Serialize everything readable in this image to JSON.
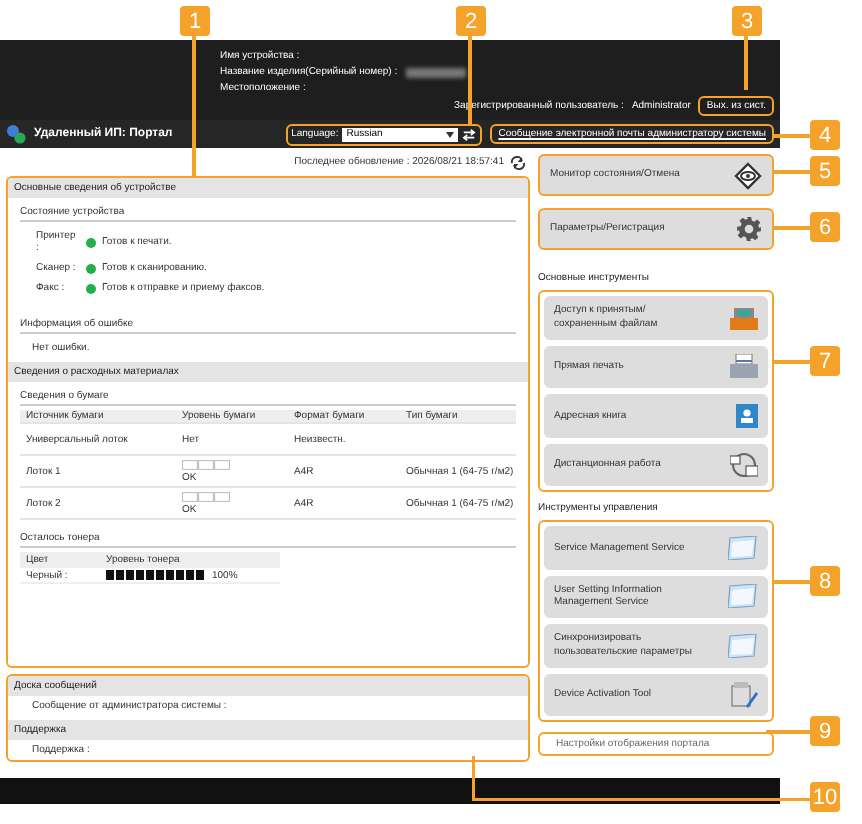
{
  "header": {
    "device_name_label": "Имя устройства :",
    "product_label": "Название изделия(Серийный номер) :",
    "location_label": "Местоположение :",
    "user_label": "Зарегистрированный пользователь :",
    "user_value": "Administrator",
    "logout_button": "Вых. из сист.",
    "portal_title": "Удаленный ИП: Портал",
    "language_label": "Language:",
    "language_value": "Russian",
    "email_link": "Сообщение электронной почты администратору системы"
  },
  "last_updated": "Последнее обновление : 2026/08/21 18:57:41",
  "device_info": {
    "title": "Основные сведения об устройстве",
    "status_title": "Состояние устройства",
    "statuses": [
      {
        "name": "Принтер :",
        "text": "Готов к печати.",
        "color": "#22b04a"
      },
      {
        "name": "Сканер :",
        "text": "Готов к сканированию.",
        "color": "#22b04a"
      },
      {
        "name": "Факс :",
        "text": "Готов к отправке и приему факсов.",
        "color": "#22b04a"
      }
    ],
    "error_title": "Информация об ошибке",
    "error_text": "Нет ошибки."
  },
  "consumables": {
    "title": "Сведения о расходных материалах",
    "paper_title": "Сведения о бумаге",
    "paper_columns": [
      "Источник бумаги",
      "Уровень бумаги",
      "Формат бумаги",
      "Тип бумаги"
    ],
    "paper_rows": [
      {
        "source": "Универсальный лоток",
        "kind": "text",
        "level_text": "Нет",
        "size": "Неизвестн."
      },
      {
        "source": "Лоток 1",
        "kind": "gauge",
        "level_text": "OK",
        "size": "A4R",
        "type": "Обычная 1 (64-75 г/м2)"
      },
      {
        "source": "Лоток 2",
        "kind": "gauge",
        "level_text": "OK",
        "size": "A4R",
        "type": "Обычная 1 (64-75 г/м2)"
      }
    ],
    "toner_title": "Осталось тонера",
    "toner_columns": [
      "Цвет",
      "Уровень тонера"
    ],
    "toners": [
      {
        "color_name": "Черный :",
        "level": 1.0,
        "reading": "100%"
      }
    ]
  },
  "message_board": {
    "title": "Доска сообщений",
    "text": "Сообщение от администратора системы :",
    "support_title": "Поддержка",
    "support_text": "Поддержка :"
  },
  "top_buttons": [
    {
      "label": "Монитор состояния/Отмена"
    },
    {
      "label": "Параметры/Регистрация"
    }
  ],
  "basic_tools": {
    "title": "Основные инструменты",
    "items": [
      {
        "label": "Доступ к принятым/ сохраненным файлам"
      },
      {
        "label": "Прямая печать"
      },
      {
        "label": "Адресная книга"
      },
      {
        "label": "Дистанционная работа"
      }
    ]
  },
  "management_tools": {
    "title": "Инструменты управления",
    "items": [
      {
        "label": "Service Management Service"
      },
      {
        "label": "User Setting Information Management Service"
      },
      {
        "label": "Синхронизировать пользовательские параметры"
      },
      {
        "label": "Device Activation Tool"
      }
    ]
  },
  "portal_settings_link": "Настройки отображения портала",
  "callouts": [
    {
      "label": "1"
    },
    {
      "label": "2"
    },
    {
      "label": "3"
    },
    {
      "label": "4"
    },
    {
      "label": "5"
    },
    {
      "label": "6"
    },
    {
      "label": "7"
    },
    {
      "label": "8"
    },
    {
      "label": "9"
    },
    {
      "label": "10"
    }
  ]
}
